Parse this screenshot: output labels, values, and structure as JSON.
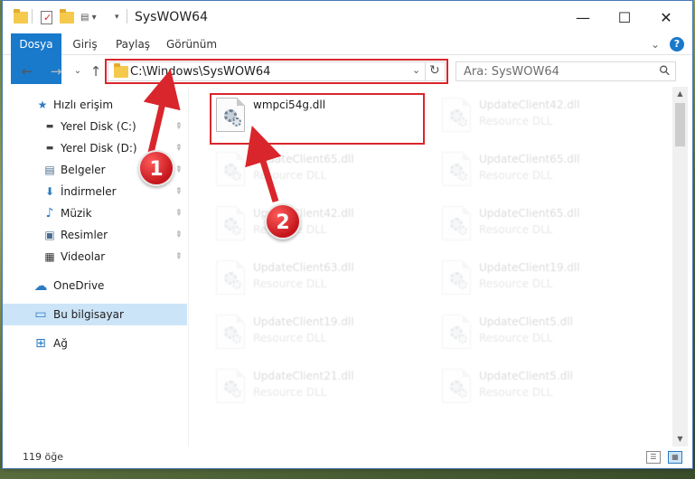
{
  "window": {
    "title": "SysWOW64",
    "controls": {
      "minimize": "—",
      "maximize": "☐",
      "close": "✕"
    }
  },
  "quick_access_toolbar": [
    "folder-icon",
    "properties-icon",
    "new-folder-icon",
    "customize-icon"
  ],
  "ribbon": {
    "tabs": [
      {
        "label": "Dosya",
        "active": true
      },
      {
        "label": "Giriş"
      },
      {
        "label": "Paylaş"
      },
      {
        "label": "Görünüm"
      }
    ],
    "expand_glyph": "⌄",
    "help_glyph": "?"
  },
  "nav": {
    "back": "←",
    "forward": "→",
    "recent": "⌄",
    "up": "↑",
    "address": "C:\\Windows\\SysWOW64",
    "address_dropdown": "⌄",
    "refresh": "↻",
    "search_placeholder": "Ara: SysWOW64",
    "search_icon": "⚲"
  },
  "sidebar": {
    "items": [
      {
        "label": "Hızlı erişim",
        "icon": "star-icon",
        "glyph": "★"
      },
      {
        "label": "Yerel Disk (C:)",
        "icon": "drive-c-icon",
        "glyph": "▬",
        "pinned": true
      },
      {
        "label": "Yerel Disk (D:)",
        "icon": "drive-d-icon",
        "glyph": "▬",
        "pinned": true
      },
      {
        "label": "Belgeler",
        "icon": "documents-icon",
        "glyph": "▤",
        "pinned": true
      },
      {
        "label": "İndirmeler",
        "icon": "downloads-icon",
        "glyph": "⬇",
        "pinned": true
      },
      {
        "label": "Müzik",
        "icon": "music-icon",
        "glyph": "♪",
        "pinned": true
      },
      {
        "label": "Resimler",
        "icon": "pictures-icon",
        "glyph": "▣",
        "pinned": true
      },
      {
        "label": "Videolar",
        "icon": "videos-icon",
        "glyph": "▦",
        "pinned": true
      },
      {
        "label": "OneDrive",
        "icon": "cloud-icon",
        "glyph": "☁"
      },
      {
        "label": "Bu bilgisayar",
        "icon": "computer-icon",
        "glyph": "▭",
        "selected": true
      },
      {
        "label": "Ağ",
        "icon": "network-icon",
        "glyph": "⊞"
      }
    ],
    "pin_glyph": "📌"
  },
  "files": [
    {
      "name": "wmpci54g.dll",
      "type": "",
      "highlighted": true
    },
    {
      "name": "UpdateClient42.dll",
      "type": "Resource DLL"
    },
    {
      "name": "UpdateClient65.dll",
      "type": "Resource DLL"
    },
    {
      "name": "UpdateClient65.dll",
      "type": "Resource DLL"
    },
    {
      "name": "UpdateClient42.dll",
      "type": "Resource DLL"
    },
    {
      "name": "UpdateClient65.dll",
      "type": "Resource DLL"
    },
    {
      "name": "UpdateClient63.dll",
      "type": "Resource DLL"
    },
    {
      "name": "UpdateClient19.dll",
      "type": "Resource DLL"
    },
    {
      "name": "UpdateClient19.dll",
      "type": "Resource DLL"
    },
    {
      "name": "UpdateClient5.dll",
      "type": "Resource DLL"
    },
    {
      "name": "UpdateClient21.dll",
      "type": "Resource DLL"
    },
    {
      "name": "UpdateClient5.dll",
      "type": "Resource DLL"
    }
  ],
  "status": {
    "item_count": "119 öğe"
  },
  "annotations": {
    "step1": "1",
    "step2": "2",
    "accent": "#d9262c"
  }
}
